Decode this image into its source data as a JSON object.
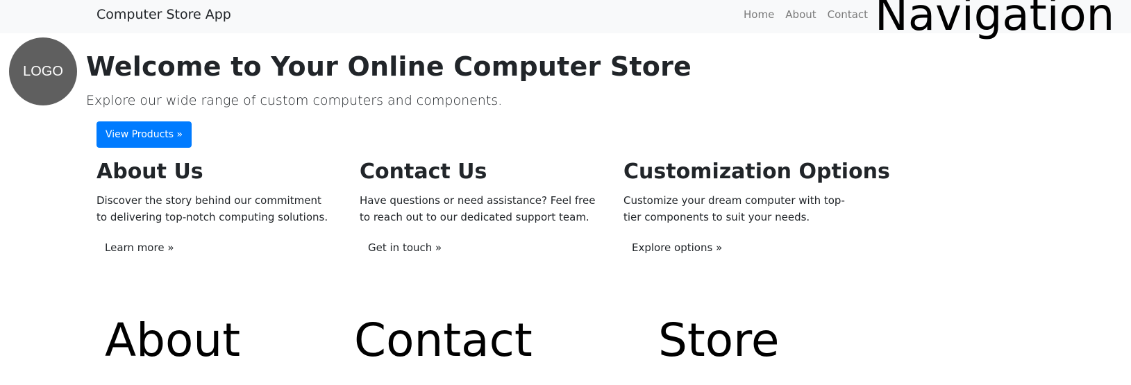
{
  "navbar": {
    "brand": "Computer Store App",
    "links": [
      "Home",
      "About",
      "Contact"
    ],
    "overlay_label": "Navigation"
  },
  "logo": {
    "text": "LOGO"
  },
  "hero": {
    "title": "Welcome to Your Online Computer Store",
    "subtitle": "Explore our wide range of custom computers and components.",
    "button_label": "View Products »"
  },
  "sections": [
    {
      "title": "About Us",
      "text": "Discover the story behind our commitment to delivering top-notch computing solutions.",
      "link": "Learn more »",
      "overlay_label": "About"
    },
    {
      "title": "Contact Us",
      "text": "Have questions or need assistance? Feel free to reach out to our dedicated support team.",
      "link": "Get in touch »",
      "overlay_label": "Contact"
    },
    {
      "title": "Customization Options",
      "text": "Customize your dream computer with top-tier components to suit your needs.",
      "link": "Explore options »",
      "overlay_label": "Store"
    }
  ],
  "colors": {
    "primary": "#007bff",
    "navbar_bg": "#f8f9fa",
    "logo_bg": "#5f5f5f",
    "text": "#212529",
    "nav_link": "#7a7a7a"
  }
}
